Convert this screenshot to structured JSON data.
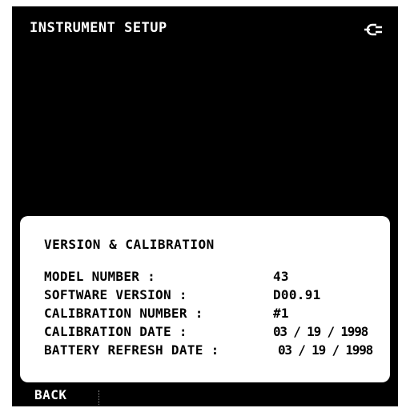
{
  "header": {
    "title": "INSTRUMENT SETUP",
    "icon": "power-plug-icon"
  },
  "dialog": {
    "title": "VERSION & CALIBRATION",
    "rows": [
      {
        "label": "MODEL NUMBER :",
        "value": "43"
      },
      {
        "label": "SOFTWARE VERSION :",
        "value": "D00.91"
      },
      {
        "label": "CALIBRATION NUMBER :",
        "value": "#1"
      },
      {
        "label": "CALIBRATION DATE :",
        "value": "03 / 19 / 1998"
      },
      {
        "label": "BATTERY REFRESH DATE :",
        "value": "03 / 19 / 1998"
      }
    ]
  },
  "footer": {
    "back_label": "BACK"
  },
  "colors": {
    "background": "#000000",
    "foreground": "#ffffff",
    "dialog_background": "#ffffff",
    "dialog_text": "#000000"
  }
}
